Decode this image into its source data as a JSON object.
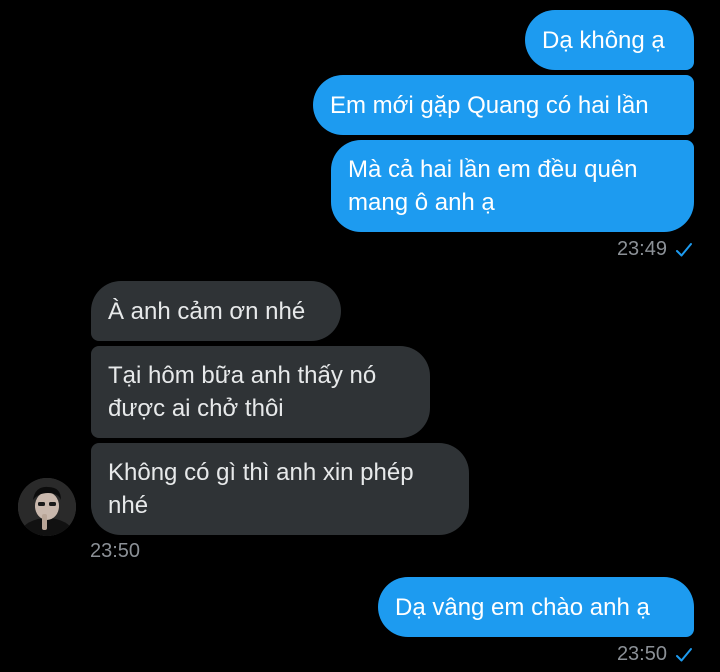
{
  "conversation": {
    "outgoing_group_1": [
      "Dạ không ạ",
      "Em mới gặp Quang có hai lần",
      "Mà cả hai lần em đều quên mang ô anh ạ"
    ],
    "outgoing_group_1_time": "23:49",
    "incoming_group": [
      "À anh cảm ơn nhé",
      "Tại hôm bữa anh thấy nó được ai chở thôi",
      "Không có gì thì anh xin phép nhé"
    ],
    "incoming_group_time": "23:50",
    "outgoing_group_2": [
      "Dạ vâng em chào anh ạ"
    ],
    "outgoing_group_2_time": "23:50"
  },
  "colors": {
    "background": "#000000",
    "outgoing_bubble": "#1d9bf0",
    "incoming_bubble": "#2f3336",
    "timestamp": "#8b9096",
    "read_check": "#1d9bf0"
  },
  "icons": {
    "read_receipt": "check-icon",
    "sender_avatar": "avatar"
  }
}
